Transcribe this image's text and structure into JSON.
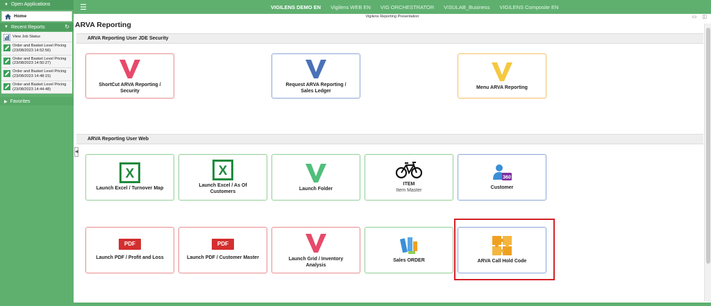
{
  "sidebar": {
    "open_apps": "Open Applications",
    "home": "Home",
    "recent_reports": "Recent Reports",
    "recent_items": [
      {
        "label": "View Job Status"
      },
      {
        "label": "Order and Basket Level Pricing",
        "time": "(23/08/2023 14:52:56)"
      },
      {
        "label": "Order and Basket Level Pricing",
        "time": "(23/08/2023 14:50:27)"
      },
      {
        "label": "Order and Basket Level Pricing",
        "time": "(23/08/2023 14:48:15)"
      },
      {
        "label": "Order and Basket Level Pricing",
        "time": "(23/08/2023 14:44:48)"
      }
    ],
    "favorites": "Favorites"
  },
  "topbar": {
    "tabs": [
      "VIGILENS DEMO EN",
      "Vigilens WEB EN",
      "VIG ORCHESTRATOR",
      "VISULAB_Business",
      "VIGILENS Composite EN"
    ]
  },
  "subtitle": "Vigilens Reporting Presentation",
  "page_title": "ARVA Reporting",
  "sections": [
    {
      "title": "ARVA Reporting User JDE Security",
      "tiles": [
        {
          "label": "ShortCut ARVA Reporting / Security"
        },
        {
          "label": "Request ARVA Reporting / Sales Ledger"
        },
        {
          "label": "Menu ARVA Reporting"
        }
      ]
    },
    {
      "title": "ARVA Reporting User Web",
      "tiles": [
        {
          "label": "Launch Excel / Turnover Map"
        },
        {
          "label": "Launch Excel / As Of Customers"
        },
        {
          "label": "Launch Folder"
        },
        {
          "label": "ITEM",
          "sub": "Item Master"
        },
        {
          "label": "Customer"
        },
        {
          "label": "Launch PDF / Profit and Loss",
          "icon_text": "PDF"
        },
        {
          "label": "Launch PDF / Customer Master",
          "icon_text": "PDF"
        },
        {
          "label": "Launch Grid / Inventory Analysis"
        },
        {
          "label": "Sales ORDER"
        },
        {
          "label": "ARVA Call Hold Code"
        }
      ]
    }
  ],
  "colors": {
    "brand_green": "#5fb06f",
    "v_red": "#e8496a",
    "v_blue": "#4a72b8",
    "v_yellow": "#f5c842",
    "v_green": "#4fbf7a",
    "excel_green": "#1e8a3c",
    "highlight": "#d32027"
  }
}
